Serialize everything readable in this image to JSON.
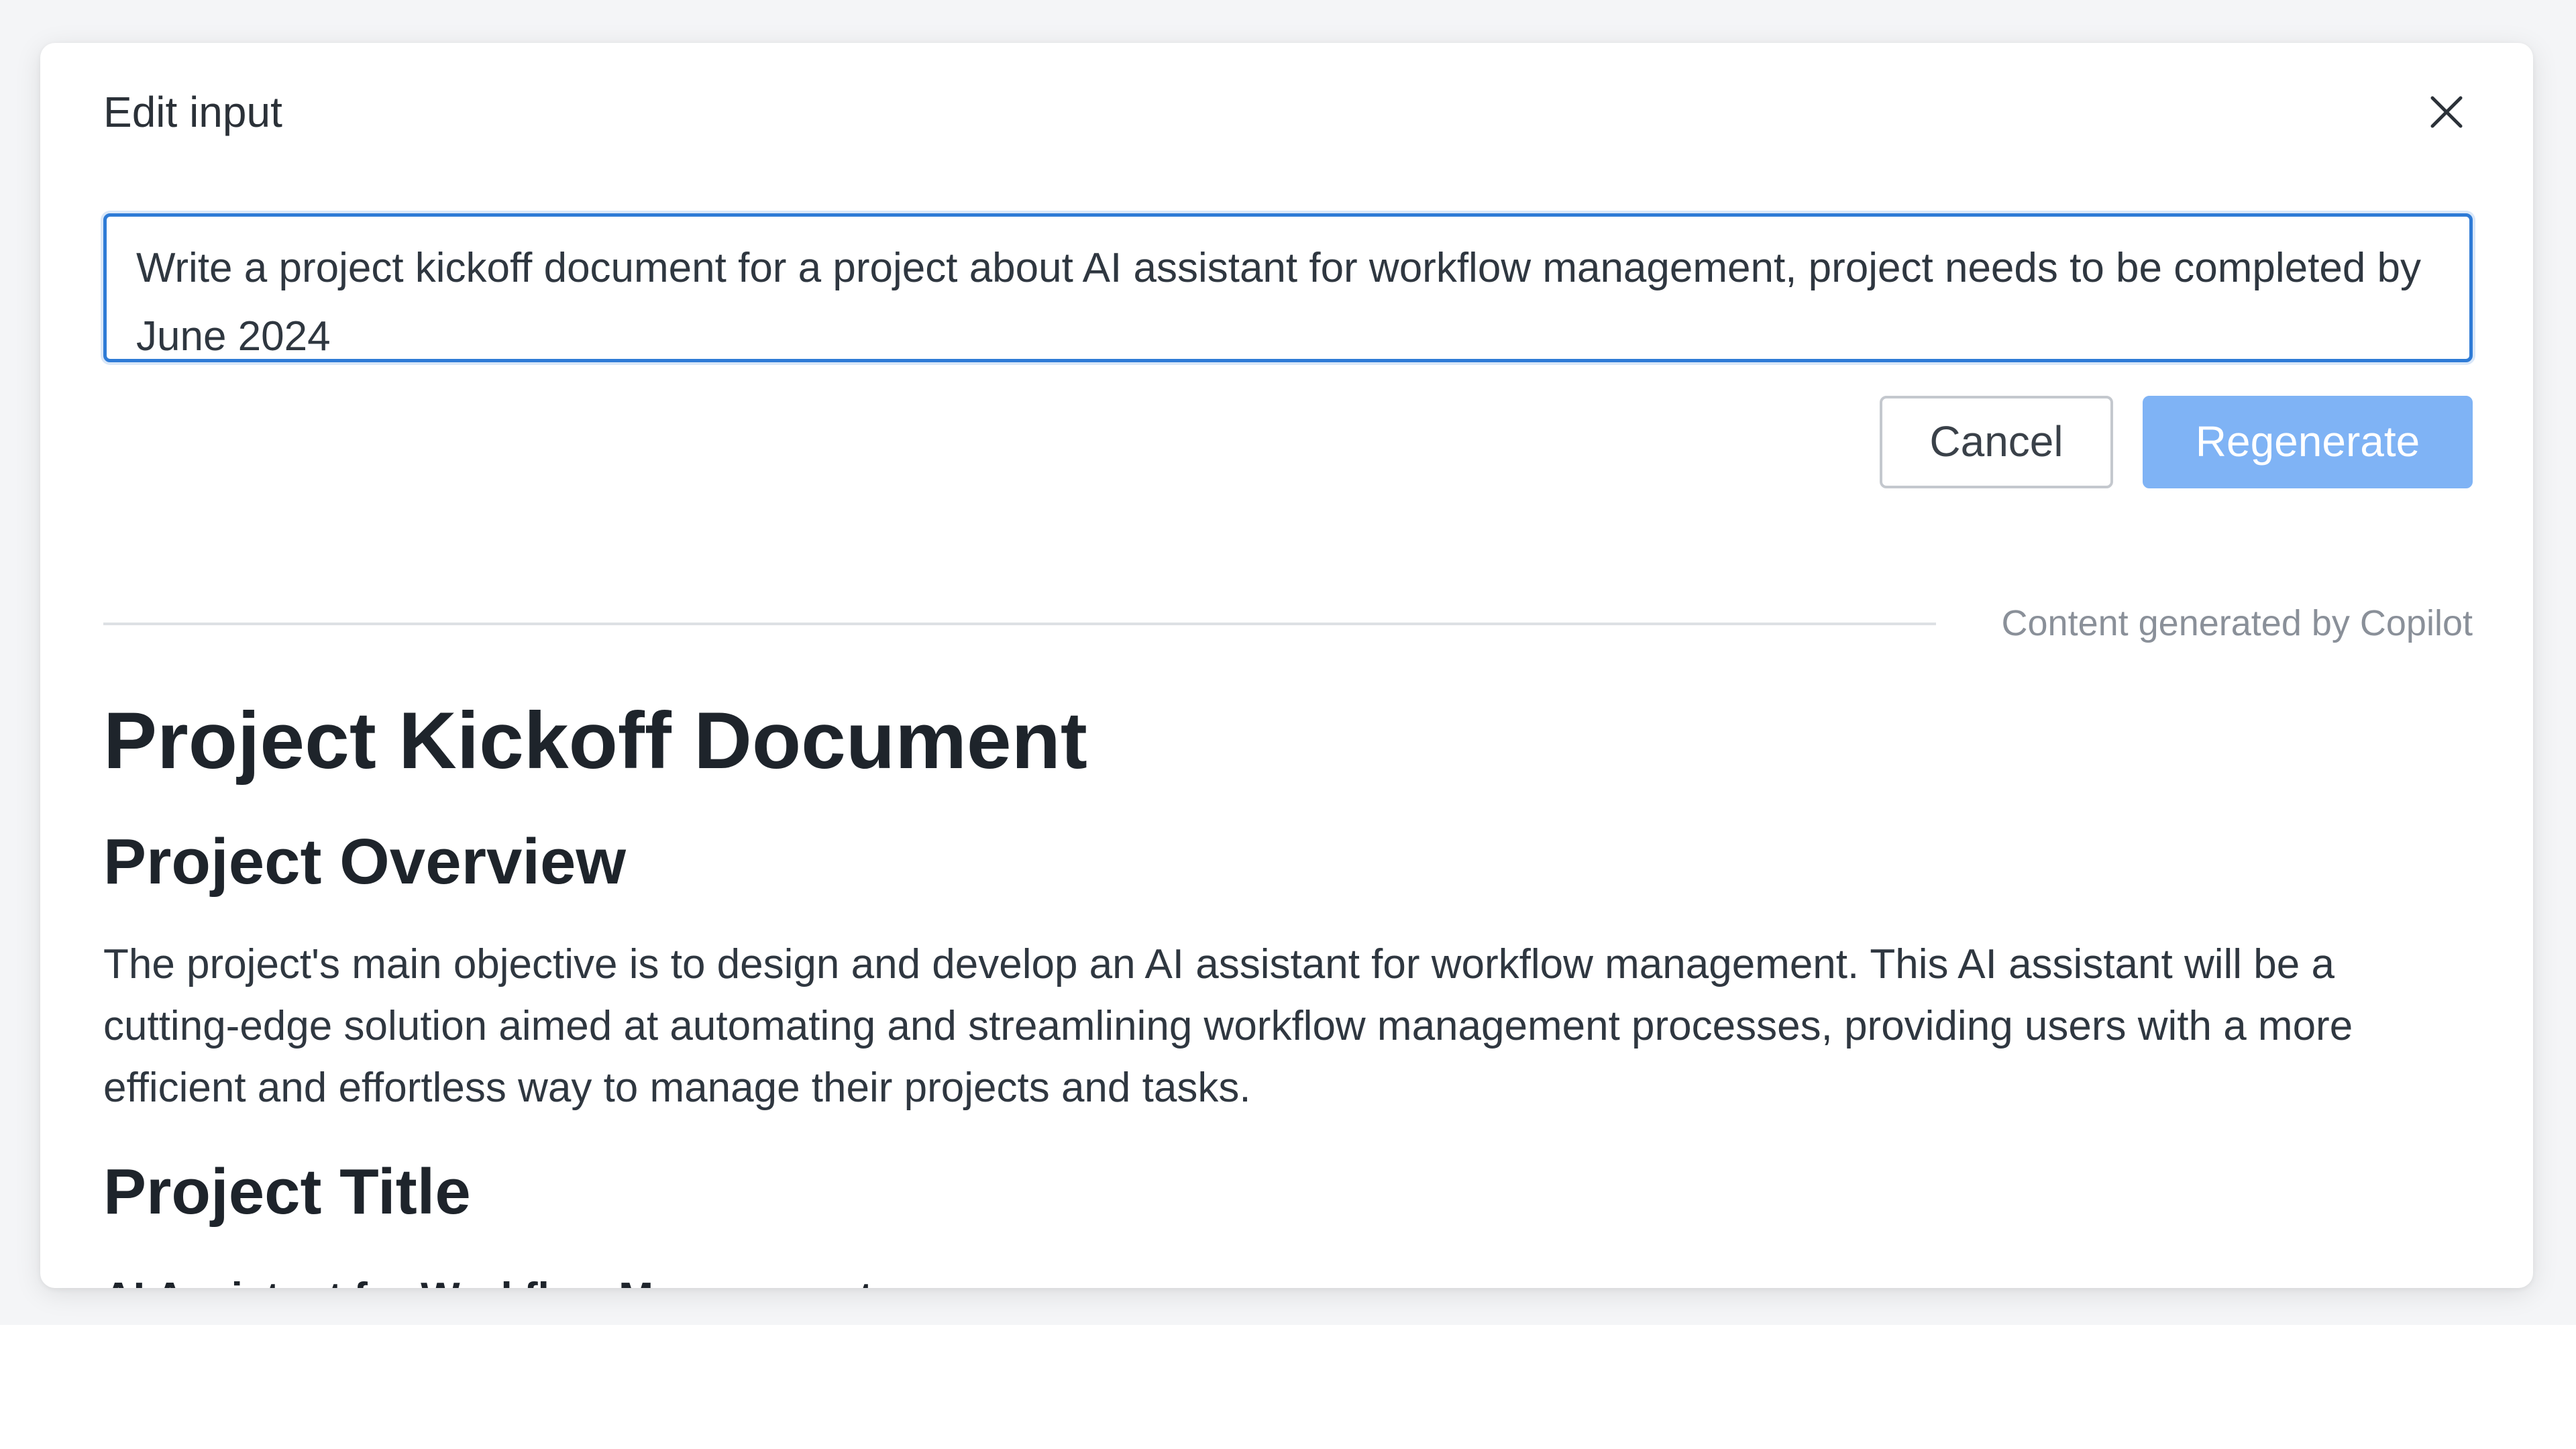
{
  "dialog": {
    "title": "Edit input",
    "close_icon": "close-icon"
  },
  "prompt": {
    "value": "Write a project kickoff document for a project about AI assistant for workflow management, project needs to be completed by June 2024"
  },
  "actions": {
    "cancel_label": "Cancel",
    "regenerate_label": "Regenerate"
  },
  "divider": {
    "caption": "Content generated by Copilot"
  },
  "document": {
    "heading": "Project Kickoff Document",
    "section1_heading": "Project Overview",
    "section1_body": "The project's main objective is to design and develop an AI assistant for workflow management. This AI assistant will be a cutting-edge solution aimed at automating and streamlining workflow management processes, providing users with a more efficient and effortless way to manage their projects and tasks.",
    "section2_heading": "Project Title",
    "section2_subheading": "AI Assistant for Workflow Management"
  },
  "colors": {
    "accent": "#2e7bd6",
    "regenerate_bg": "#7fb3f5",
    "caption": "#8a9099"
  }
}
